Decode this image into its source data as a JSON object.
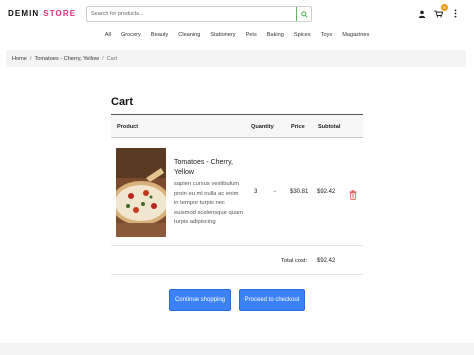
{
  "header": {
    "logo_part1": "DEMIN",
    "logo_part2": "STORE",
    "search_placeholder": "Search for products...",
    "cart_count": "0"
  },
  "nav": {
    "items": [
      "All",
      "Grocery",
      "Beauty",
      "Cleaning",
      "Stationery",
      "Pets",
      "Baking",
      "Spices",
      "Toys",
      "Magazines"
    ]
  },
  "breadcrumb": {
    "home": "Home",
    "sep": "/",
    "product": "Tomatoes - Cherry, Yellow",
    "current": "Cart"
  },
  "cart": {
    "title": "Cart",
    "headers": {
      "product": "Product",
      "quantity": "Quantity",
      "price": "Price",
      "subtotal": "Subtotal"
    },
    "item": {
      "name": "Tomatoes - Cherry, Yellow",
      "description": "sapien cursus vestibulum proin eu mi nulla ac enim in tempor turpis nec euismod scelerisque quam turpis adipiscing",
      "quantity": "3",
      "decrement": "−",
      "price": "$30.81",
      "subtotal": "$92.42"
    },
    "total_label": "Total cost:",
    "total_value": "$92.42",
    "continue_label": "Continue shopping",
    "checkout_label": "Proceed to checkout"
  },
  "colors": {
    "brand_accent": "#e0307f",
    "button_primary": "#3b82f6",
    "search_green": "#5cb85c",
    "trash_red": "#d9534f",
    "badge_orange": "#f39c12"
  }
}
